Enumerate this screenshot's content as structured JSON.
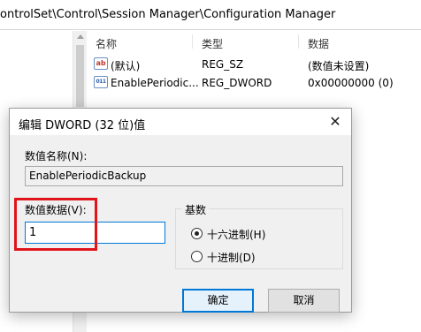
{
  "address": {
    "path": "ontrolSet\\Control\\Session Manager\\Configuration Manager"
  },
  "list": {
    "headers": {
      "name": "名称",
      "type": "类型",
      "data": "数据"
    },
    "rows": [
      {
        "icon": "string-value-icon",
        "icon_text": "ab",
        "name": "(默认)",
        "type": "REG_SZ",
        "data": "(数值未设置)"
      },
      {
        "icon": "binary-value-icon",
        "icon_text": "011",
        "name": "EnablePeriodic...",
        "type": "REG_DWORD",
        "data": "0x00000000 (0)"
      }
    ]
  },
  "dialog": {
    "title": "编辑 DWORD (32 位)值",
    "close": "✕",
    "value_name_label": "数值名称(N):",
    "value_name": "EnablePeriodicBackup",
    "value_data_label": "数值数据(V):",
    "value_data": "1",
    "base_label": "基数",
    "radix_options": [
      {
        "label": "十六进制(H)",
        "selected": true
      },
      {
        "label": "十进制(D)",
        "selected": false
      }
    ],
    "ok_label": "确定",
    "cancel_label": "取消"
  },
  "colors": {
    "highlight": "#e0151b",
    "focus": "#0078d7",
    "dialog_bg": "#f0f0f0"
  }
}
